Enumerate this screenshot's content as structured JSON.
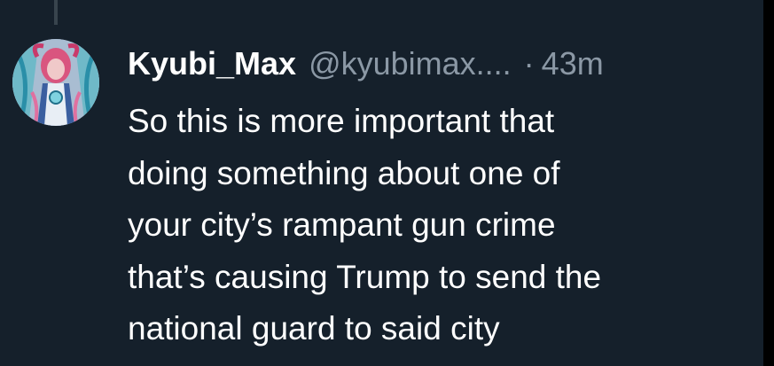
{
  "tweet": {
    "author_name": "Kyubi_Max",
    "handle": "@kyubimax....",
    "separator": "·",
    "time_ago": "43m",
    "text_lines": [
      "So this is more important that",
      "doing something about one of",
      "your city’s rampant gun crime",
      "that’s causing Trump to send the",
      "national guard to said city"
    ]
  },
  "colors": {
    "background": "#15202b",
    "primary_text": "#ffffff",
    "secondary_text": "#8b98a5",
    "thread_line": "#38444d"
  },
  "icons": {
    "avatar": "anime-character-avatar"
  }
}
